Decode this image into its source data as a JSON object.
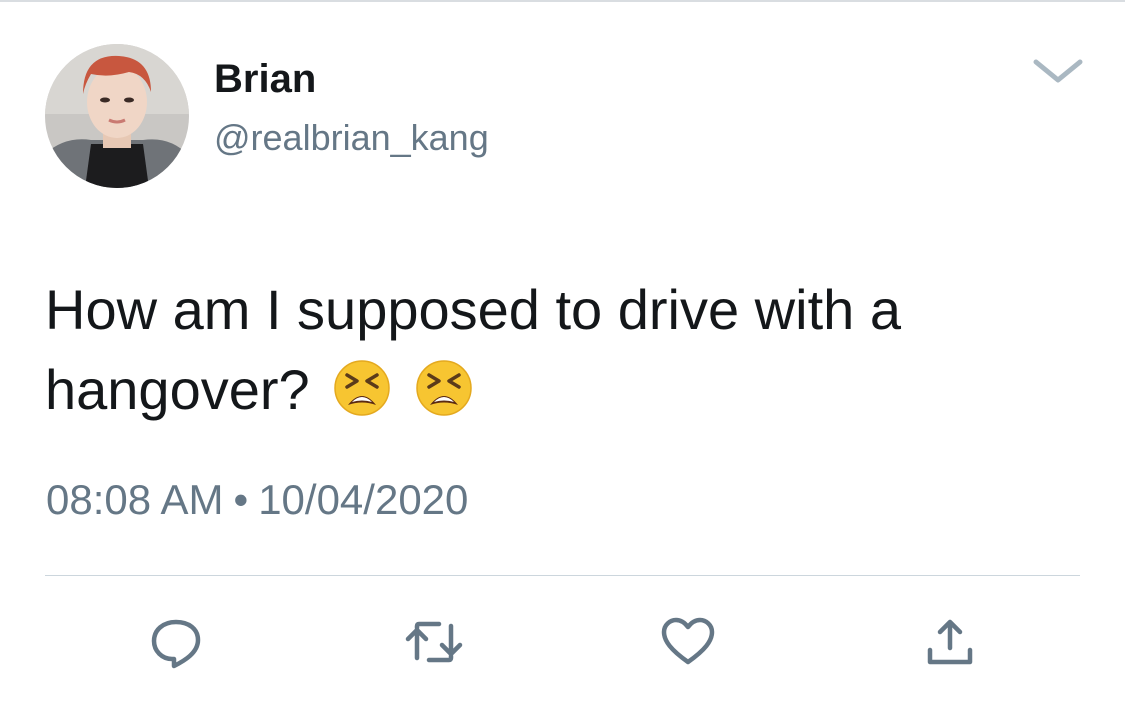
{
  "tweet": {
    "author": {
      "display_name": "Brian",
      "handle": "@realbrian_kang"
    },
    "text": "How am I supposed to drive with a hangover?",
    "emojis": [
      "tired-face-emoji",
      "tired-face-emoji"
    ],
    "timestamp": {
      "time": "08:08 AM",
      "separator": "•",
      "date": "10/04/2020"
    }
  },
  "actions": [
    {
      "name": "reply",
      "icon": "comment-icon"
    },
    {
      "name": "retweet",
      "icon": "retweet-icon"
    },
    {
      "name": "like",
      "icon": "heart-icon"
    },
    {
      "name": "share",
      "icon": "share-icon"
    }
  ],
  "colors": {
    "text_primary": "#14171a",
    "text_secondary": "#657786",
    "icon": "#657786",
    "divider": "#ccd6dd"
  }
}
